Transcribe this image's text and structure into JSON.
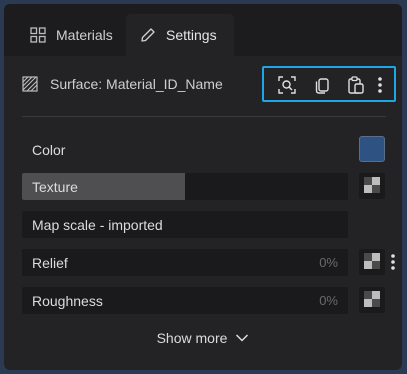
{
  "tabs": [
    {
      "label": "Materials",
      "icon": "grid-icon",
      "active": false
    },
    {
      "label": "Settings",
      "icon": "pencil-icon",
      "active": true
    }
  ],
  "surface": {
    "label": "Surface: Material_ID_Name",
    "icon": "hatch-icon"
  },
  "toolbar": {
    "highlight_color": "#1ea6e6",
    "buttons": [
      "zoom-select-icon",
      "copy-icon",
      "paste-icon",
      "more-vertical-icon"
    ]
  },
  "properties": {
    "color": {
      "label": "Color",
      "swatch": "#2e5282"
    },
    "texture": {
      "label": "Texture",
      "fill_fraction": 0.5
    },
    "map_scale": {
      "label": "Map scale - imported"
    },
    "relief": {
      "label": "Relief",
      "value": "0%"
    },
    "roughness": {
      "label": "Roughness",
      "value": "0%"
    }
  },
  "show_more": {
    "label": "Show more"
  },
  "colors": {
    "panel": "#232325",
    "field": "#1a1a1c",
    "accent": "#1ea6e6"
  }
}
